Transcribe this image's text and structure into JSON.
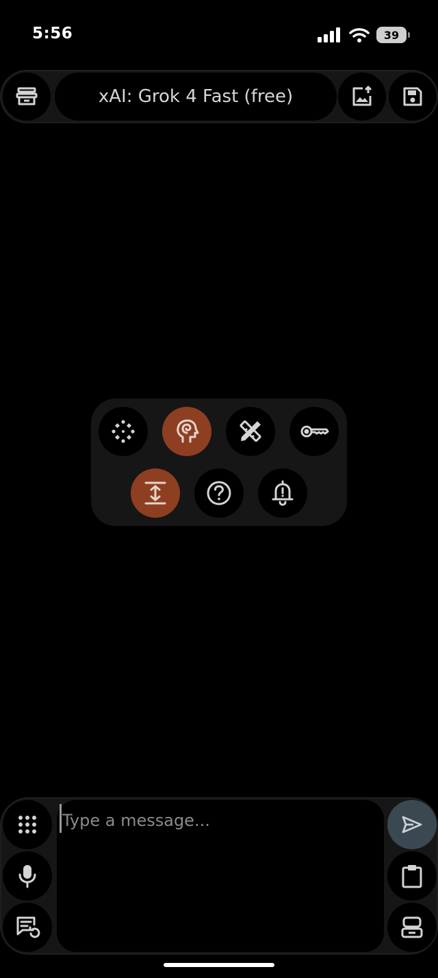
{
  "status_bar": {
    "time": "5:56",
    "battery_level": "39"
  },
  "header": {
    "model_name": "xAI: Grok 4 Fast (free)",
    "icons": [
      "archive-icon",
      "image-upload-icon",
      "save-icon"
    ]
  },
  "quick_actions": {
    "items": [
      {
        "icon": "sparkle-icon",
        "active": false
      },
      {
        "icon": "brain-head-icon",
        "active": true
      },
      {
        "icon": "tools-icon",
        "active": false
      },
      {
        "icon": "key-icon",
        "active": false
      },
      {
        "icon": "expand-vertical-icon",
        "active": true
      },
      {
        "icon": "help-icon",
        "active": false
      },
      {
        "icon": "bell-alert-icon",
        "active": false
      }
    ]
  },
  "composer": {
    "placeholder": "Type a message...",
    "value": "",
    "left_icons": [
      "grid-icon",
      "microphone-icon",
      "chat-history-icon"
    ],
    "right_icons": [
      "send-icon",
      "clipboard-icon",
      "robot-icon"
    ]
  },
  "colors": {
    "background": "#000000",
    "panel": "#161616",
    "accent_active": "#8e3f22",
    "send_button": "#3a4852",
    "icon": "#d4d4d4"
  }
}
